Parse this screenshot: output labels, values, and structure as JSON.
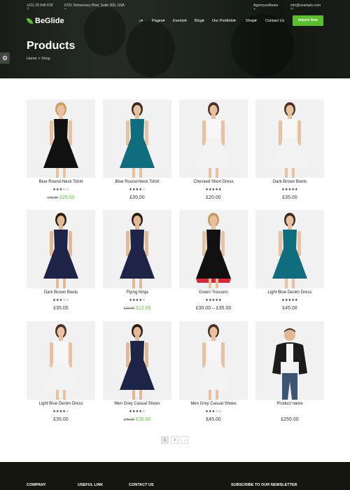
{
  "topbar": {
    "phone": "+011 25 549 678",
    "address": "6701 Democracy Blvd, Suite 300, USA",
    "agency": "Agencysoftware",
    "email": "info@example.com"
  },
  "brand": {
    "name": "BeGlide"
  },
  "nav": {
    "home_icon": "home-icon",
    "items": [
      "Pages",
      "Events",
      "Blog",
      "Our Portfolio",
      "Shop",
      "Contact Us"
    ],
    "cta": "Inquire Now"
  },
  "page": {
    "title": "Products",
    "breadcrumb": "Home > Shop"
  },
  "colors": {
    "accent": "#5bbf2c",
    "footer_bg": "#15160f"
  },
  "products": [
    {
      "name": "Blue Round-Neck Tshirt",
      "stars": "★★★☆☆",
      "old_price": "£45.00",
      "price": "£25.00",
      "figure": "black-dress"
    },
    {
      "name": "Blue Round-Neck Tshirt",
      "stars": "★★★★☆",
      "old_price": "",
      "price": "£35.00",
      "figure": "teal-dress"
    },
    {
      "name": "Checked Short Dress",
      "stars": "★★★★★",
      "old_price": "",
      "price": "£20.00",
      "figure": "white-dress"
    },
    {
      "name": "Dark Brown Boots",
      "stars": "★★★★★",
      "old_price": "",
      "price": "£35.00",
      "figure": "white-dress"
    },
    {
      "name": "Dark Brown Boots",
      "stars": "★★★☆☆",
      "old_price": "",
      "price": "£35.00",
      "figure": "navy-dress"
    },
    {
      "name": "Flying Ninja",
      "stars": "★★★★☆",
      "old_price": "£15.00",
      "price": "£12.00",
      "figure": "navy-dress"
    },
    {
      "name": "Green Trousers",
      "stars": "★★★★★",
      "old_price": "",
      "price": "£30.00 – £35.00",
      "figure": "black-red-dress"
    },
    {
      "name": "Light Blue Denim Dress",
      "stars": "★★★★★",
      "old_price": "",
      "price": "£45.00",
      "figure": "teal-dress"
    },
    {
      "name": "Light Blue Denim Dress",
      "stars": "★★★★☆",
      "old_price": "",
      "price": "£35.00",
      "figure": "white-dress"
    },
    {
      "name": "Men Grey Casual Shoes",
      "stars": "★★★★☆",
      "old_price": "£45.00",
      "price": "£35.00",
      "figure": "navy-dress"
    },
    {
      "name": "Men Grey Casual Shoes",
      "stars": "★★★☆☆",
      "old_price": "",
      "price": "£45.00",
      "figure": "white-dress"
    },
    {
      "name": "Product name",
      "stars": "",
      "old_price": "",
      "price": "£255.00",
      "figure": "man-jacket"
    }
  ],
  "pagination": [
    "1",
    "2",
    "→"
  ],
  "footer": {
    "columns": [
      "COMPANY",
      "USEFUL LINK",
      "CONTACT US",
      "SUBSCRIBE TO OUR NEWSLETTER"
    ]
  }
}
